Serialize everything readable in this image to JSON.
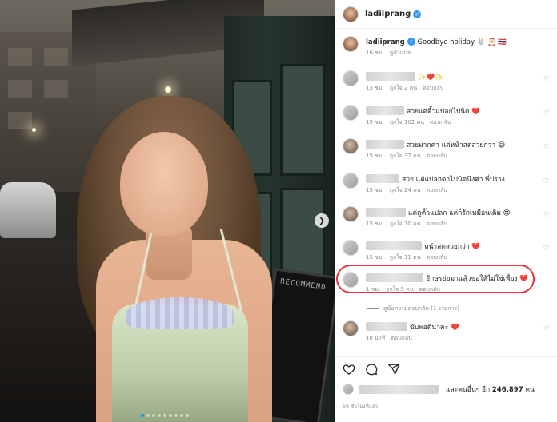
{
  "post": {
    "username": "ladiiprang",
    "caption_text": "Goodbye holiday 🐰 🎅 🇹🇭",
    "caption_age": "16 ชม.",
    "caption_translate": "ดูคำแปล",
    "sign_text": "RECOMMEND",
    "next_icon": "chevron-right-icon"
  },
  "comments": [
    {
      "text": "✨❤️✨",
      "age": "15 ชม.",
      "likes": "ถูกใจ 2 คน",
      "reply": "ตอบกลับ"
    },
    {
      "text": "สวยแต่คิ้วแปลกไปนิด ❤️",
      "age": "15 ชม.",
      "likes": "ถูกใจ 102 คน",
      "reply": "ตอบกลับ"
    },
    {
      "text": "สวยมากค่า แต่หน้าสดสวยกว่า 😂",
      "age": "15 ชม.",
      "likes": "ถูกใจ 37 คน",
      "reply": "ตอบกลับ"
    },
    {
      "text": "สวย แต่แปลกตาไปนิดนึงค่า พี่ปราง",
      "age": "15 ชม.",
      "likes": "ถูกใจ 24 คน",
      "reply": "ตอบกลับ"
    },
    {
      "text": "แค่ดูคิ้วแปลก แต่ก็รักเหมือนเดิม 😍",
      "age": "15 ชม.",
      "likes": "ถูกใจ 10 คน",
      "reply": "ตอบกลับ"
    },
    {
      "text": "หน้าสดสวยกว่า ❤️",
      "age": "15 ชม.",
      "likes": "ถูกใจ 11 คน",
      "reply": "ตอบกลับ"
    },
    {
      "text": "อักษรย่อมาแล้วขอให้ไม่ใช่เพื่อง ❤️",
      "age": "1 ชม.",
      "likes": "ถูกใจ 9 คน",
      "reply": "ตอบกลับ"
    },
    {
      "text": "ขับพอดีน่าคะ ❤️",
      "age": "10 นาที",
      "likes": "",
      "reply": "ตอบกลับ"
    }
  ],
  "view_replies": "ดูข้อความตอบกลับ (1 รายการ)",
  "likes_summary": {
    "prefix": "และคนอื่นๆ อีก",
    "count": "246,897",
    "suffix": "คน"
  },
  "time_ago": "16 ชั่วโมงที่แล้ว",
  "colors": {
    "accent": "#0095f6",
    "highlight": "#e2333a",
    "verified": "#3897f0"
  }
}
